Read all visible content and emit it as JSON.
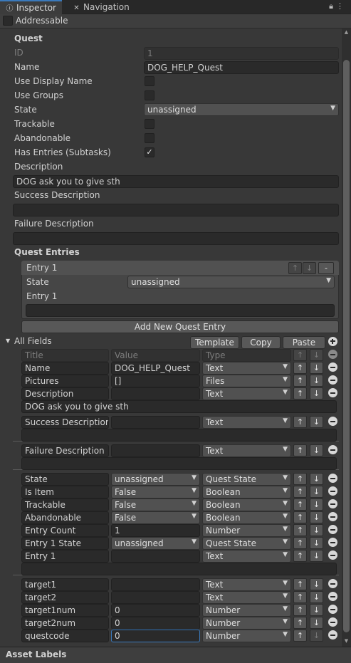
{
  "tabs": [
    {
      "label": "Inspector",
      "icon": "info-icon"
    },
    {
      "label": "Navigation",
      "icon": "navigation-icon"
    }
  ],
  "addressable_label": "Addressable",
  "quest": {
    "header": "Quest",
    "id_label": "ID",
    "id_value": "1",
    "name_label": "Name",
    "name_value": "DOG_HELP_Quest",
    "use_display_name_label": "Use Display Name",
    "use_groups_label": "Use Groups",
    "state_label": "State",
    "state_value": "unassigned",
    "trackable_label": "Trackable",
    "abandonable_label": "Abandonable",
    "has_entries_label": "Has Entries (Subtasks)",
    "has_entries_checked": true,
    "description_label": "Description",
    "description_value": "DOG ask you to give sth",
    "success_description_label": "Success Description",
    "success_description_value": "",
    "failure_description_label": "Failure Description",
    "failure_description_value": ""
  },
  "quest_entries": {
    "header": "Quest Entries",
    "entry_title": "Entry 1",
    "state_label": "State",
    "state_value": "unassigned",
    "entry_text_label": "Entry 1",
    "entry_text_value": "",
    "add_button": "Add New Quest Entry",
    "move_up": "↑",
    "move_down": "↓",
    "remove": "-"
  },
  "all_fields": {
    "header": "All Fields",
    "template_button": "Template",
    "copy_button": "Copy",
    "paste_button": "Paste",
    "col_title": "Title",
    "col_value": "Value",
    "col_type": "Type",
    "up": "↑",
    "down": "↓",
    "rows": [
      {
        "title": "Name",
        "value": "DOG_HELP_Quest",
        "value_kind": "text",
        "type": "Text"
      },
      {
        "title": "Pictures",
        "value": "[]",
        "value_kind": "text",
        "type": "Files"
      },
      {
        "title": "Description",
        "value": "",
        "value_kind": "text",
        "type": "Text",
        "long_value": "DOG ask you to give sth"
      },
      {
        "title": "Success Description",
        "value": "",
        "value_kind": "text",
        "type": "Text",
        "long_value": ""
      },
      {
        "title": "Failure Description",
        "value": "",
        "value_kind": "text",
        "type": "Text",
        "long_value": ""
      },
      {
        "title": "State",
        "value": "unassigned",
        "value_kind": "dropdown",
        "type": "Quest State"
      },
      {
        "title": "Is Item",
        "value": "False",
        "value_kind": "dropdown",
        "type": "Boolean"
      },
      {
        "title": "Trackable",
        "value": "False",
        "value_kind": "dropdown",
        "type": "Boolean"
      },
      {
        "title": "Abandonable",
        "value": "False",
        "value_kind": "dropdown",
        "type": "Boolean"
      },
      {
        "title": "Entry Count",
        "value": "1",
        "value_kind": "text",
        "type": "Number"
      },
      {
        "title": "Entry 1 State",
        "value": "unassigned",
        "value_kind": "dropdown",
        "type": "Quest State"
      },
      {
        "title": "Entry 1",
        "value": "",
        "value_kind": "text",
        "type": "Text",
        "long_value": ""
      },
      {
        "title": "target1",
        "value": "",
        "value_kind": "text",
        "type": "Text"
      },
      {
        "title": "target2",
        "value": "",
        "value_kind": "text",
        "type": "Text"
      },
      {
        "title": "target1num",
        "value": "0",
        "value_kind": "text",
        "type": "Number"
      },
      {
        "title": "target2num",
        "value": "0",
        "value_kind": "text",
        "type": "Number"
      },
      {
        "title": "questcode",
        "value": "0",
        "value_kind": "text",
        "type": "Number",
        "focused": true
      }
    ]
  },
  "footer_label": "Asset Labels"
}
